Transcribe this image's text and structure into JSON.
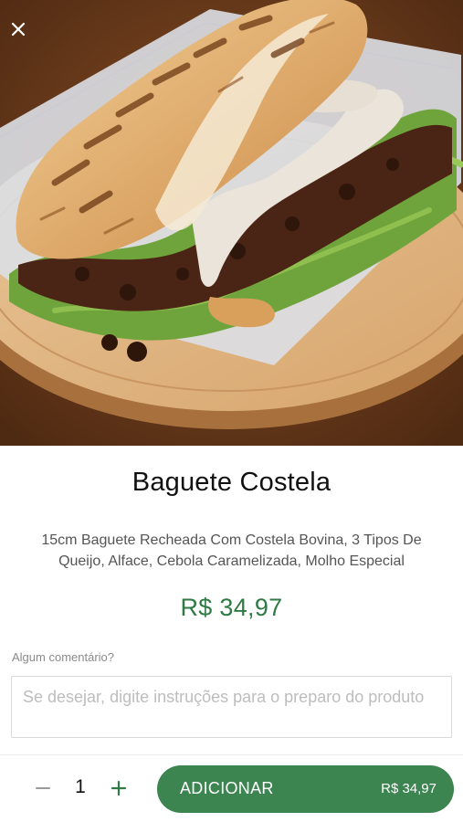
{
  "product": {
    "title": "Baguete Costela",
    "description": "15cm Baguete Recheada Com Costela Bovina, 3 Tipos De Queijo, Alface, Cebola Caramelizada, Molho Especial",
    "price": "R$ 34,97",
    "image_icon": "sandwich-photo"
  },
  "comment": {
    "label": "Algum comentário?",
    "placeholder": "Se desejar, digite instruções para o preparo do produto"
  },
  "footer": {
    "quantity": "1",
    "add_label": "ADICIONAR",
    "add_price": "R$ 34,97"
  },
  "colors": {
    "accent": "#3c8551",
    "price_text": "#2f7a45",
    "background": "#ffffff"
  },
  "icons": {
    "close": "close-icon",
    "minus": "minus-icon",
    "plus": "plus-icon"
  }
}
